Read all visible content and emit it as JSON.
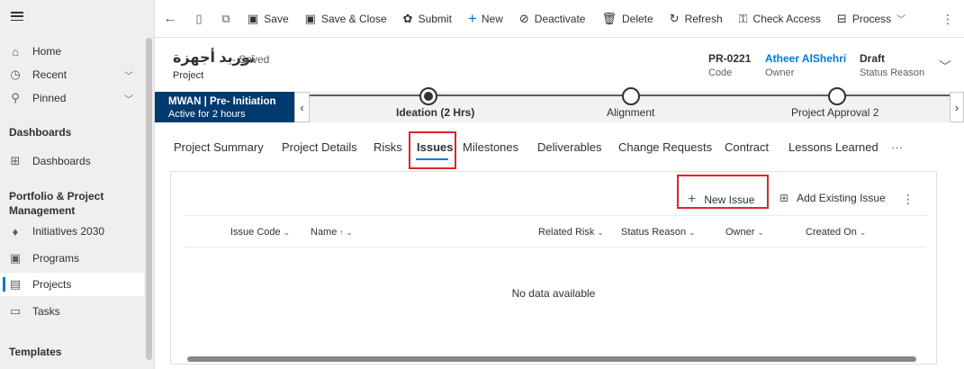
{
  "sidebar": {
    "items": [
      {
        "label": "Home",
        "icon": "home-icon"
      },
      {
        "label": "Recent",
        "icon": "clock-icon"
      },
      {
        "label": "Pinned",
        "icon": "pin-icon"
      }
    ],
    "groups": [
      {
        "title": "Dashboards",
        "items": [
          {
            "label": "Dashboards",
            "icon": "dashboard-icon"
          }
        ]
      },
      {
        "title": "Portfolio & Project Management",
        "items": [
          {
            "label": "Initiatives 2030",
            "icon": "bulb-icon"
          },
          {
            "label": "Programs",
            "icon": "grid-icon"
          },
          {
            "label": "Projects",
            "icon": "projects-icon",
            "selected": true
          },
          {
            "label": "Tasks",
            "icon": "tasks-icon"
          }
        ]
      },
      {
        "title": "Templates",
        "items": []
      }
    ]
  },
  "command_bar": {
    "save": "Save",
    "save_close": "Save & Close",
    "submit": "Submit",
    "new": "New",
    "deactivate": "Deactivate",
    "delete": "Delete",
    "refresh": "Refresh",
    "check_access": "Check Access",
    "process": "Process"
  },
  "record": {
    "title": "توريد أجهزة",
    "saved_state": "- Saved",
    "entity": "Project",
    "header_fields": [
      {
        "value": "PR-0221",
        "label": "Code"
      },
      {
        "value": "Atheer AlShehri",
        "label": "Owner"
      },
      {
        "value": "Draft",
        "label": "Status Reason"
      }
    ]
  },
  "bpf": {
    "active_stage_name": "MWAN | Pre- Initiation",
    "active_duration": "Active for 2 hours",
    "stages": [
      "Ideation  (2 Hrs)",
      "Alignment",
      "Project Approval 2"
    ]
  },
  "tabs": [
    "Project Summary",
    "Project Details",
    "Risks",
    "Issues",
    "Milestones",
    "Deliverables",
    "Change Requests",
    "Contract",
    "Lessons Learned",
    "···"
  ],
  "selected_tab": "Issues",
  "subgrid": {
    "new_label": "New Issue",
    "add_existing_label": "Add Existing Issue",
    "columns": [
      {
        "label": "Issue Code",
        "sort": "⌄"
      },
      {
        "label": "Name",
        "sort": "↑ ⌄"
      },
      {
        "label": "Related Risk",
        "sort": "⌄"
      },
      {
        "label": "Status Reason",
        "sort": "⌄"
      },
      {
        "label": "Owner",
        "sort": "⌄"
      },
      {
        "label": "Created On",
        "sort": "⌄"
      }
    ],
    "empty_message": "No data available"
  },
  "colors": {
    "accent": "#0078d4",
    "bpf_active": "#003a6e",
    "highlight": "#e02424"
  }
}
